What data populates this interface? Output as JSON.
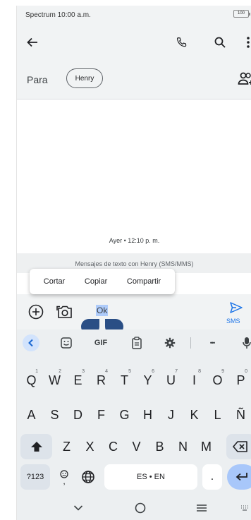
{
  "status_bar": {
    "text": "Spectrum 10:00 a.m.",
    "battery": "100"
  },
  "app_bar": {
    "back": "back",
    "call": "call",
    "search": "search",
    "more": "more"
  },
  "recipient": {
    "to_label": "Para",
    "chip_name": "Henry"
  },
  "conversation": {
    "timestamp": "Ayer • 12:10 p. m.",
    "note": "Mensajes de texto con Henry (SMS/MMS)"
  },
  "selection_menu": {
    "cut": "Cortar",
    "copy": "Copiar",
    "share": "Compartir"
  },
  "compose": {
    "text": "Ok",
    "send_label": "SMS"
  },
  "keyboard": {
    "toolbar": {
      "gif": "GIF",
      "more": "•••"
    },
    "row1": [
      {
        "k": "Q",
        "h": "1"
      },
      {
        "k": "W",
        "h": "2"
      },
      {
        "k": "E",
        "h": "3"
      },
      {
        "k": "R",
        "h": "4"
      },
      {
        "k": "T",
        "h": "5"
      },
      {
        "k": "Y",
        "h": "6"
      },
      {
        "k": "U",
        "h": "7"
      },
      {
        "k": "I",
        "h": "8"
      },
      {
        "k": "O",
        "h": "9"
      },
      {
        "k": "P",
        "h": "0"
      }
    ],
    "row2": [
      "A",
      "S",
      "D",
      "F",
      "G",
      "H",
      "J",
      "K",
      "L",
      "Ñ"
    ],
    "row3": [
      "Z",
      "X",
      "C",
      "V",
      "B",
      "N",
      "M"
    ],
    "symbols_label": "?123",
    "emoji_sub": ",",
    "space_label": "ES • EN",
    "period_label": "."
  },
  "colors": {
    "accent": "#1a73e8",
    "surface": "#f1f3f4",
    "keyboard_bg": "#eceff1",
    "selection": "#aecbfa",
    "handle": "#2a4e85"
  }
}
